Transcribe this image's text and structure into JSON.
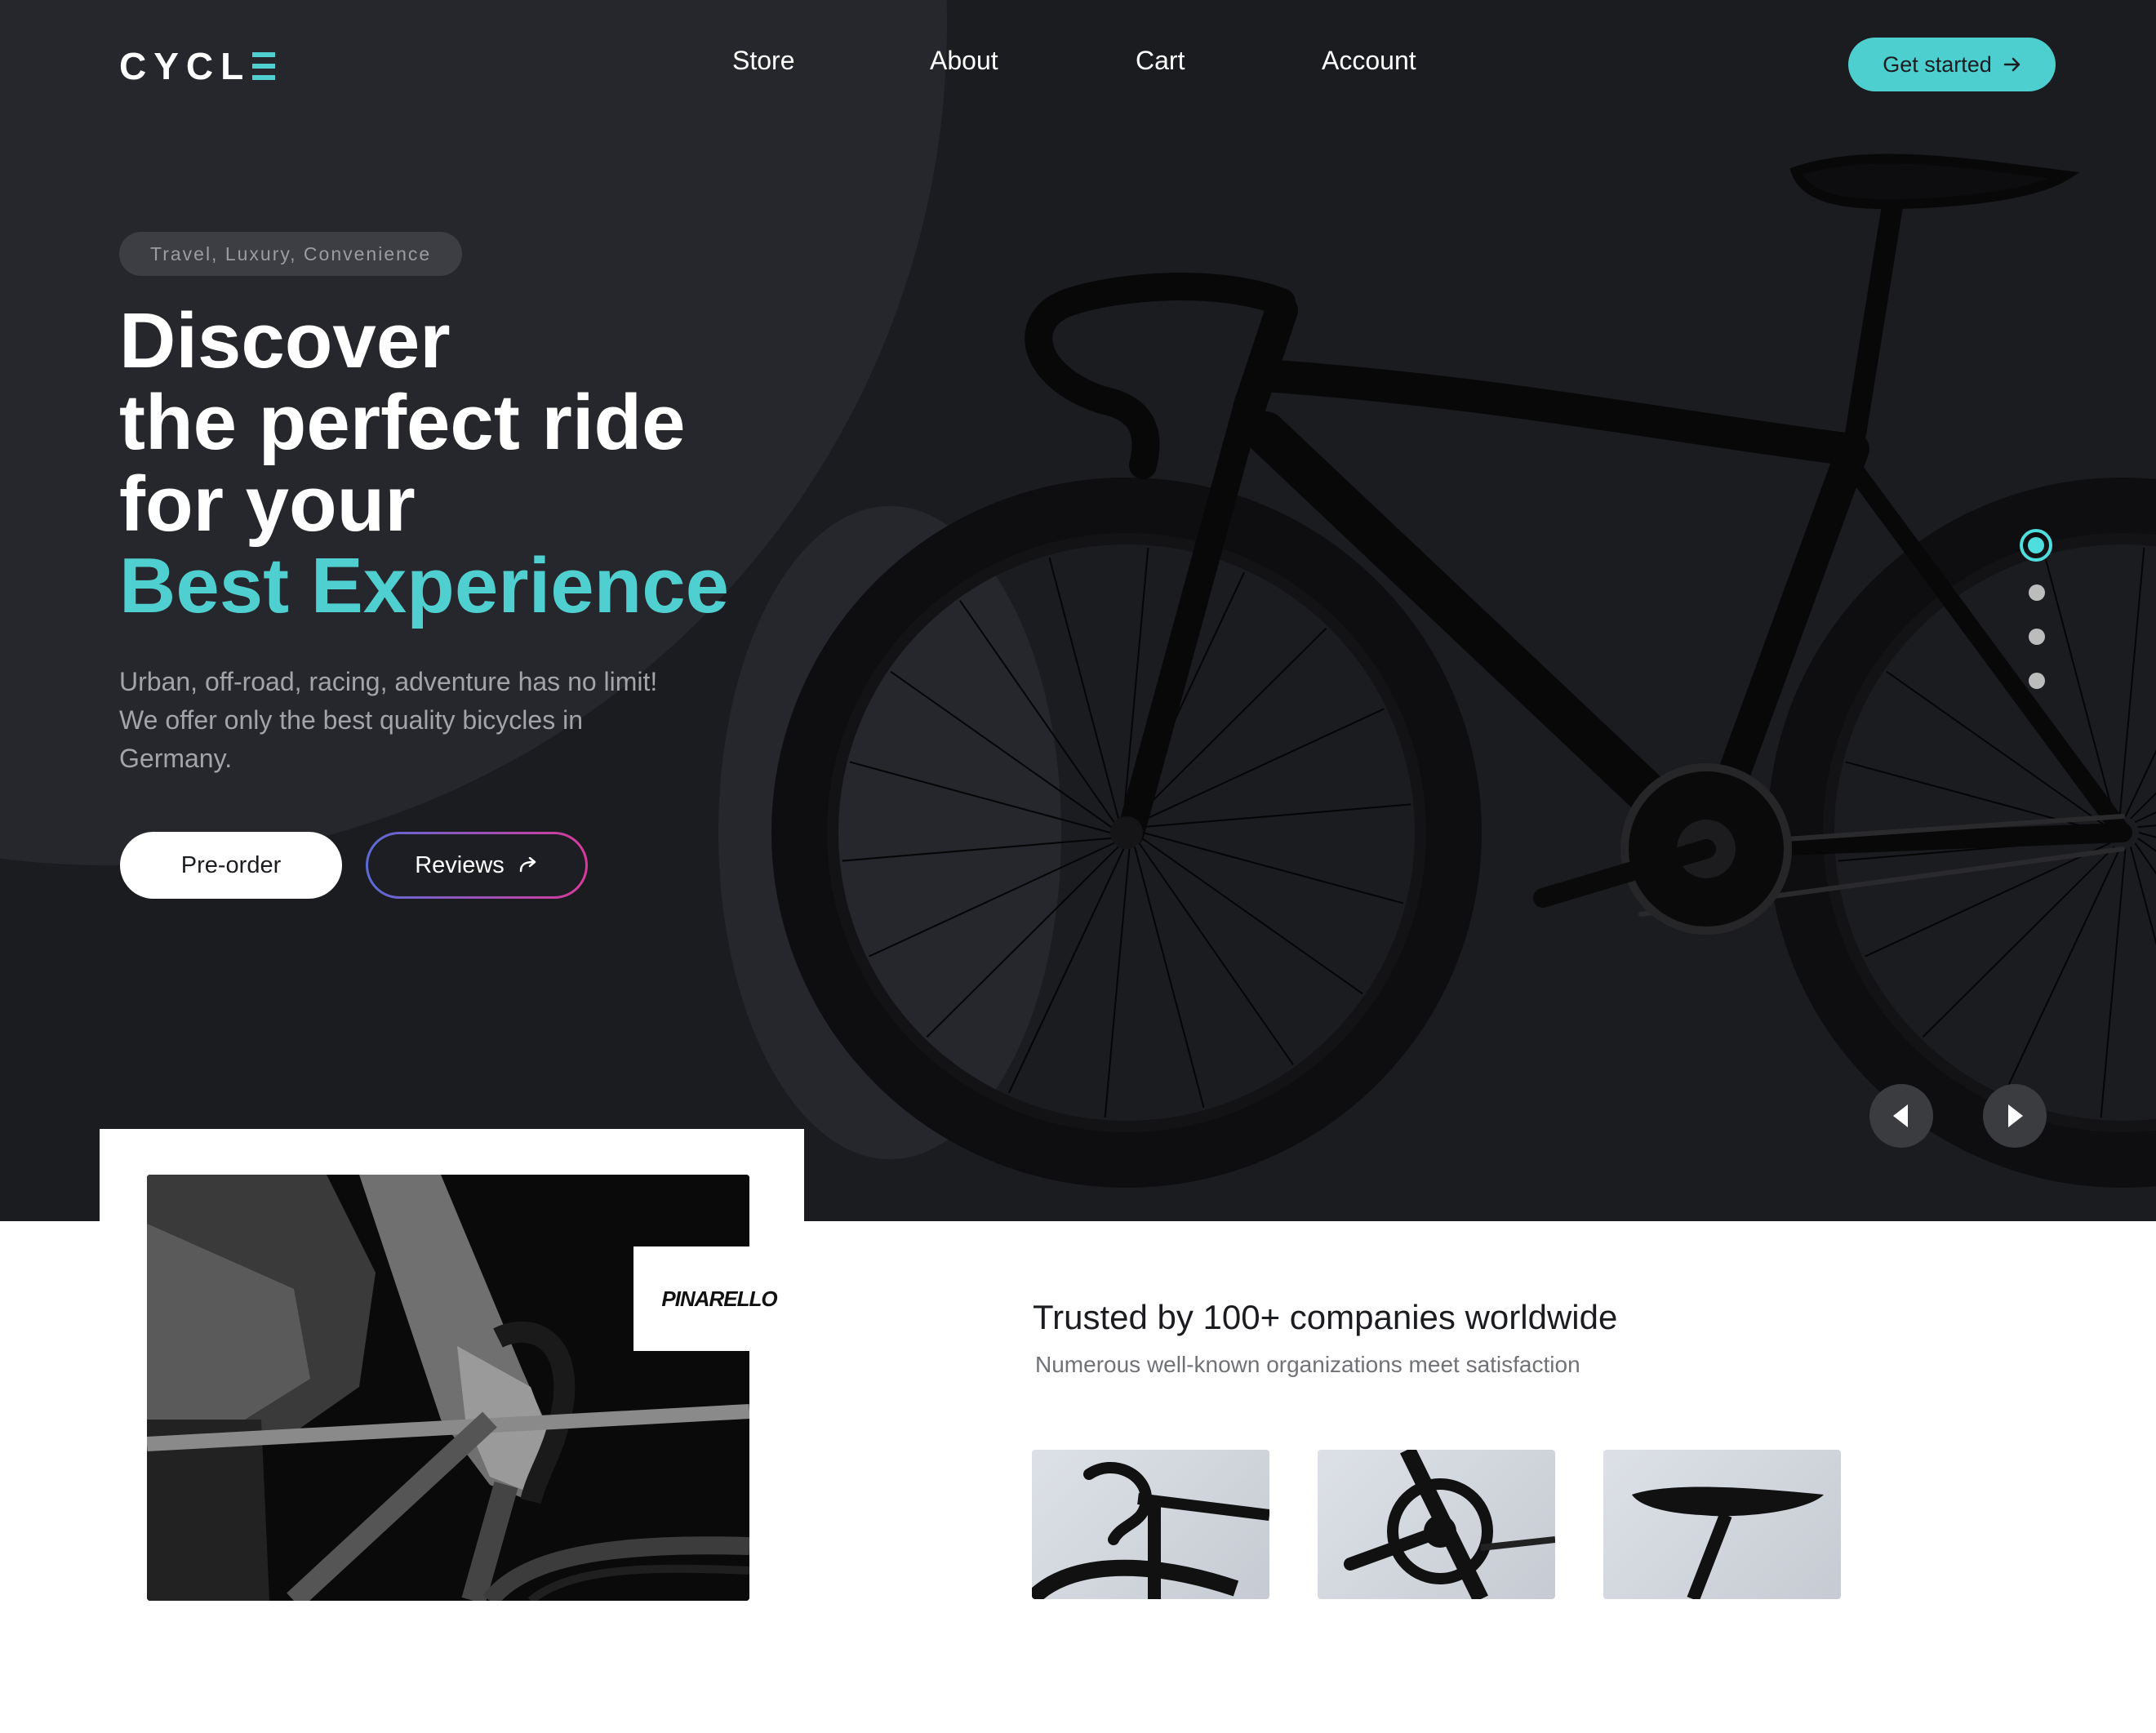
{
  "nav": {
    "logo": "CYCL",
    "items": [
      "Store",
      "About",
      "Cart",
      "Account"
    ],
    "cta_label": "Get started"
  },
  "hero": {
    "tagline": "Travel, Luxury, Convenience",
    "headline_lines": [
      "Discover",
      "the perfect ride",
      "for your"
    ],
    "headline_accent": "Best Experience",
    "subtext": "Urban, off-road, racing, adventure has no limit! We offer only the best quality bicycles in Germany.",
    "preorder_label": "Pre-order",
    "reviews_label": "Reviews"
  },
  "carousel": {
    "slide_count": 4,
    "active_slide": 1
  },
  "brand": {
    "name": "PINARELLO"
  },
  "trusted": {
    "title": "Trusted by 100+ companies worldwide",
    "subtitle": "Numerous well-known organizations meet satisfaction"
  },
  "thumbnails": [
    "handlebar",
    "crankset",
    "saddle"
  ],
  "colors": {
    "accent": "#4fcfcf",
    "hero_bg": "#1b1c20",
    "hero_shape": "#25272c"
  }
}
